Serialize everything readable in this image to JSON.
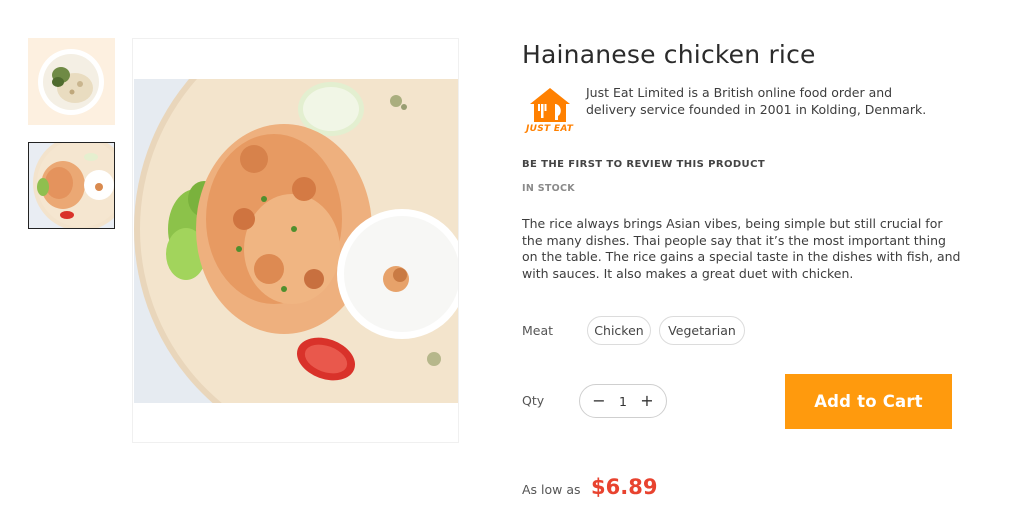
{
  "product": {
    "title": "Hainanese chicken rice",
    "brand": {
      "logo_text": "JUST EAT",
      "description": "Just Eat Limited is a British online food order and delivery service founded in 2001 in Kolding, Denmark."
    },
    "review_link": "BE THE FIRST TO REVIEW THIS PRODUCT",
    "stock_status": "IN STOCK",
    "description": "The rice always brings Asian vibes, being simple but still crucial for the many dishes. Thai people say that it’s the most important thing on the table. The rice gains a special taste in the dishes with fish, and with sauces. It also makes a great duet with chicken.",
    "option": {
      "label": "Meat",
      "choices": [
        "Chicken",
        "Vegetarian"
      ]
    },
    "quantity": {
      "label": "Qty",
      "value": "1",
      "decrement": "−",
      "increment": "+"
    },
    "add_to_cart_label": "Add to Cart",
    "price": {
      "prefix": "As low as",
      "value": "$6.89"
    }
  },
  "colors": {
    "accent": "#ff9a0d",
    "price": "#e8432f",
    "brand": "#ff8000"
  },
  "icons": [
    "house-fork-knife-logo",
    "minus-icon",
    "plus-icon"
  ]
}
